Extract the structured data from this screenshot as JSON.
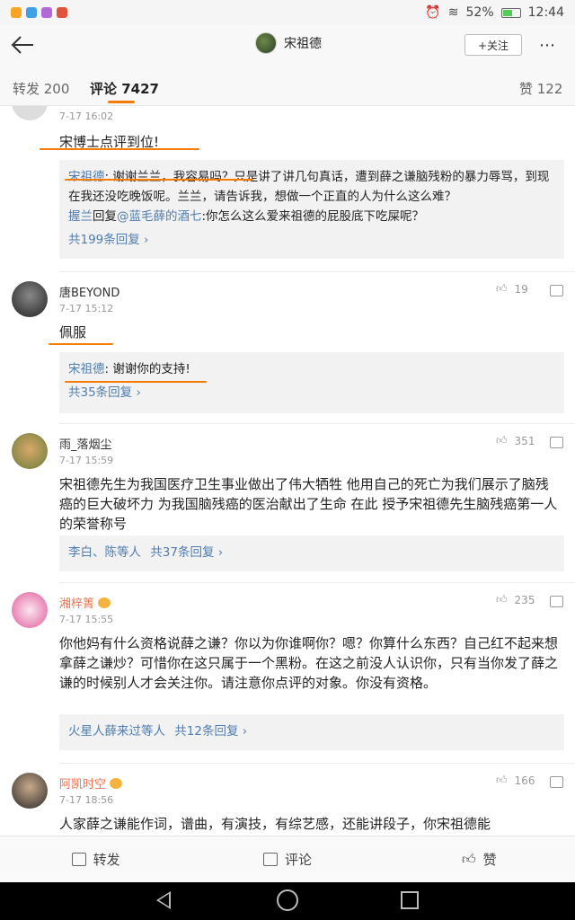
{
  "status": {
    "battery": "52%",
    "time": "12:44"
  },
  "nav": {
    "title": "宋祖德",
    "follow": "+关注"
  },
  "tabs": {
    "repost": "转发 200",
    "comments": "评论 7427",
    "likes": "赞 122"
  },
  "comments": [
    {
      "time": "7-17 16:02",
      "text": "宋博士点评到位!",
      "replies": [
        {
          "author": "宋祖德",
          "sep": ": ",
          "text": "谢谢兰兰，我容易吗？只是讲了讲几句真话，遭到薛之谦脑残粉的暴力辱骂，到现在我还没吃晚饭呢。兰兰，请告诉我，想做一个正直的人为什么这么难？"
        },
        {
          "author": "握兰",
          "mid": "回复",
          "target": "@蓝毛薛的酒七",
          "text": ":你怎么这么爱来祖德的屁股底下吃屎呢？"
        }
      ],
      "more": "共199条回复 ›"
    },
    {
      "name": "唐BEYOND",
      "time": "7-17 15:12",
      "likes": "19",
      "text": "佩服",
      "replies": [
        {
          "author": "宋祖德",
          "sep": ": ",
          "text": "谢谢你的支持!"
        }
      ],
      "more": "共35条回复 ›"
    },
    {
      "name": "雨_落烟尘",
      "time": "7-17 15:59",
      "likes": "351",
      "text": "宋祖德先生为我国医疗卫生事业做出了伟大牺牲 他用自己的死亡为我们展示了脑残癌的巨大破坏力 为我国脑残癌的医治献出了生命 在此 授予宋祖德先生脑残癌第一人的荣誉称号",
      "replied_by": "李白、陈等人",
      "more": "共37条回复 ›"
    },
    {
      "name": "湘梓箐",
      "time": "7-17 15:55",
      "likes": "235",
      "text": "你他妈有什么资格说薛之谦？你以为你谁啊你？嗯？你算什么东西？自己红不起来想拿薛之谦炒？可惜你在这只属于一个黑粉。在这之前没人认识你，只有当你发了薛之谦的时候别人才会关注你。请注意你点评的对象。你没有资格。",
      "replied_by": "火星人薛来过等人",
      "more": "共12条回复 ›"
    },
    {
      "name": "阿凯时空",
      "time": "7-17 18:56",
      "likes": "166",
      "text": "人家薛之谦能作词，谱曲，有演技，有综艺感，还能讲段子，你宋祖德能"
    }
  ],
  "bottom": {
    "repost": "转发",
    "comment": "评论",
    "like": "赞"
  }
}
